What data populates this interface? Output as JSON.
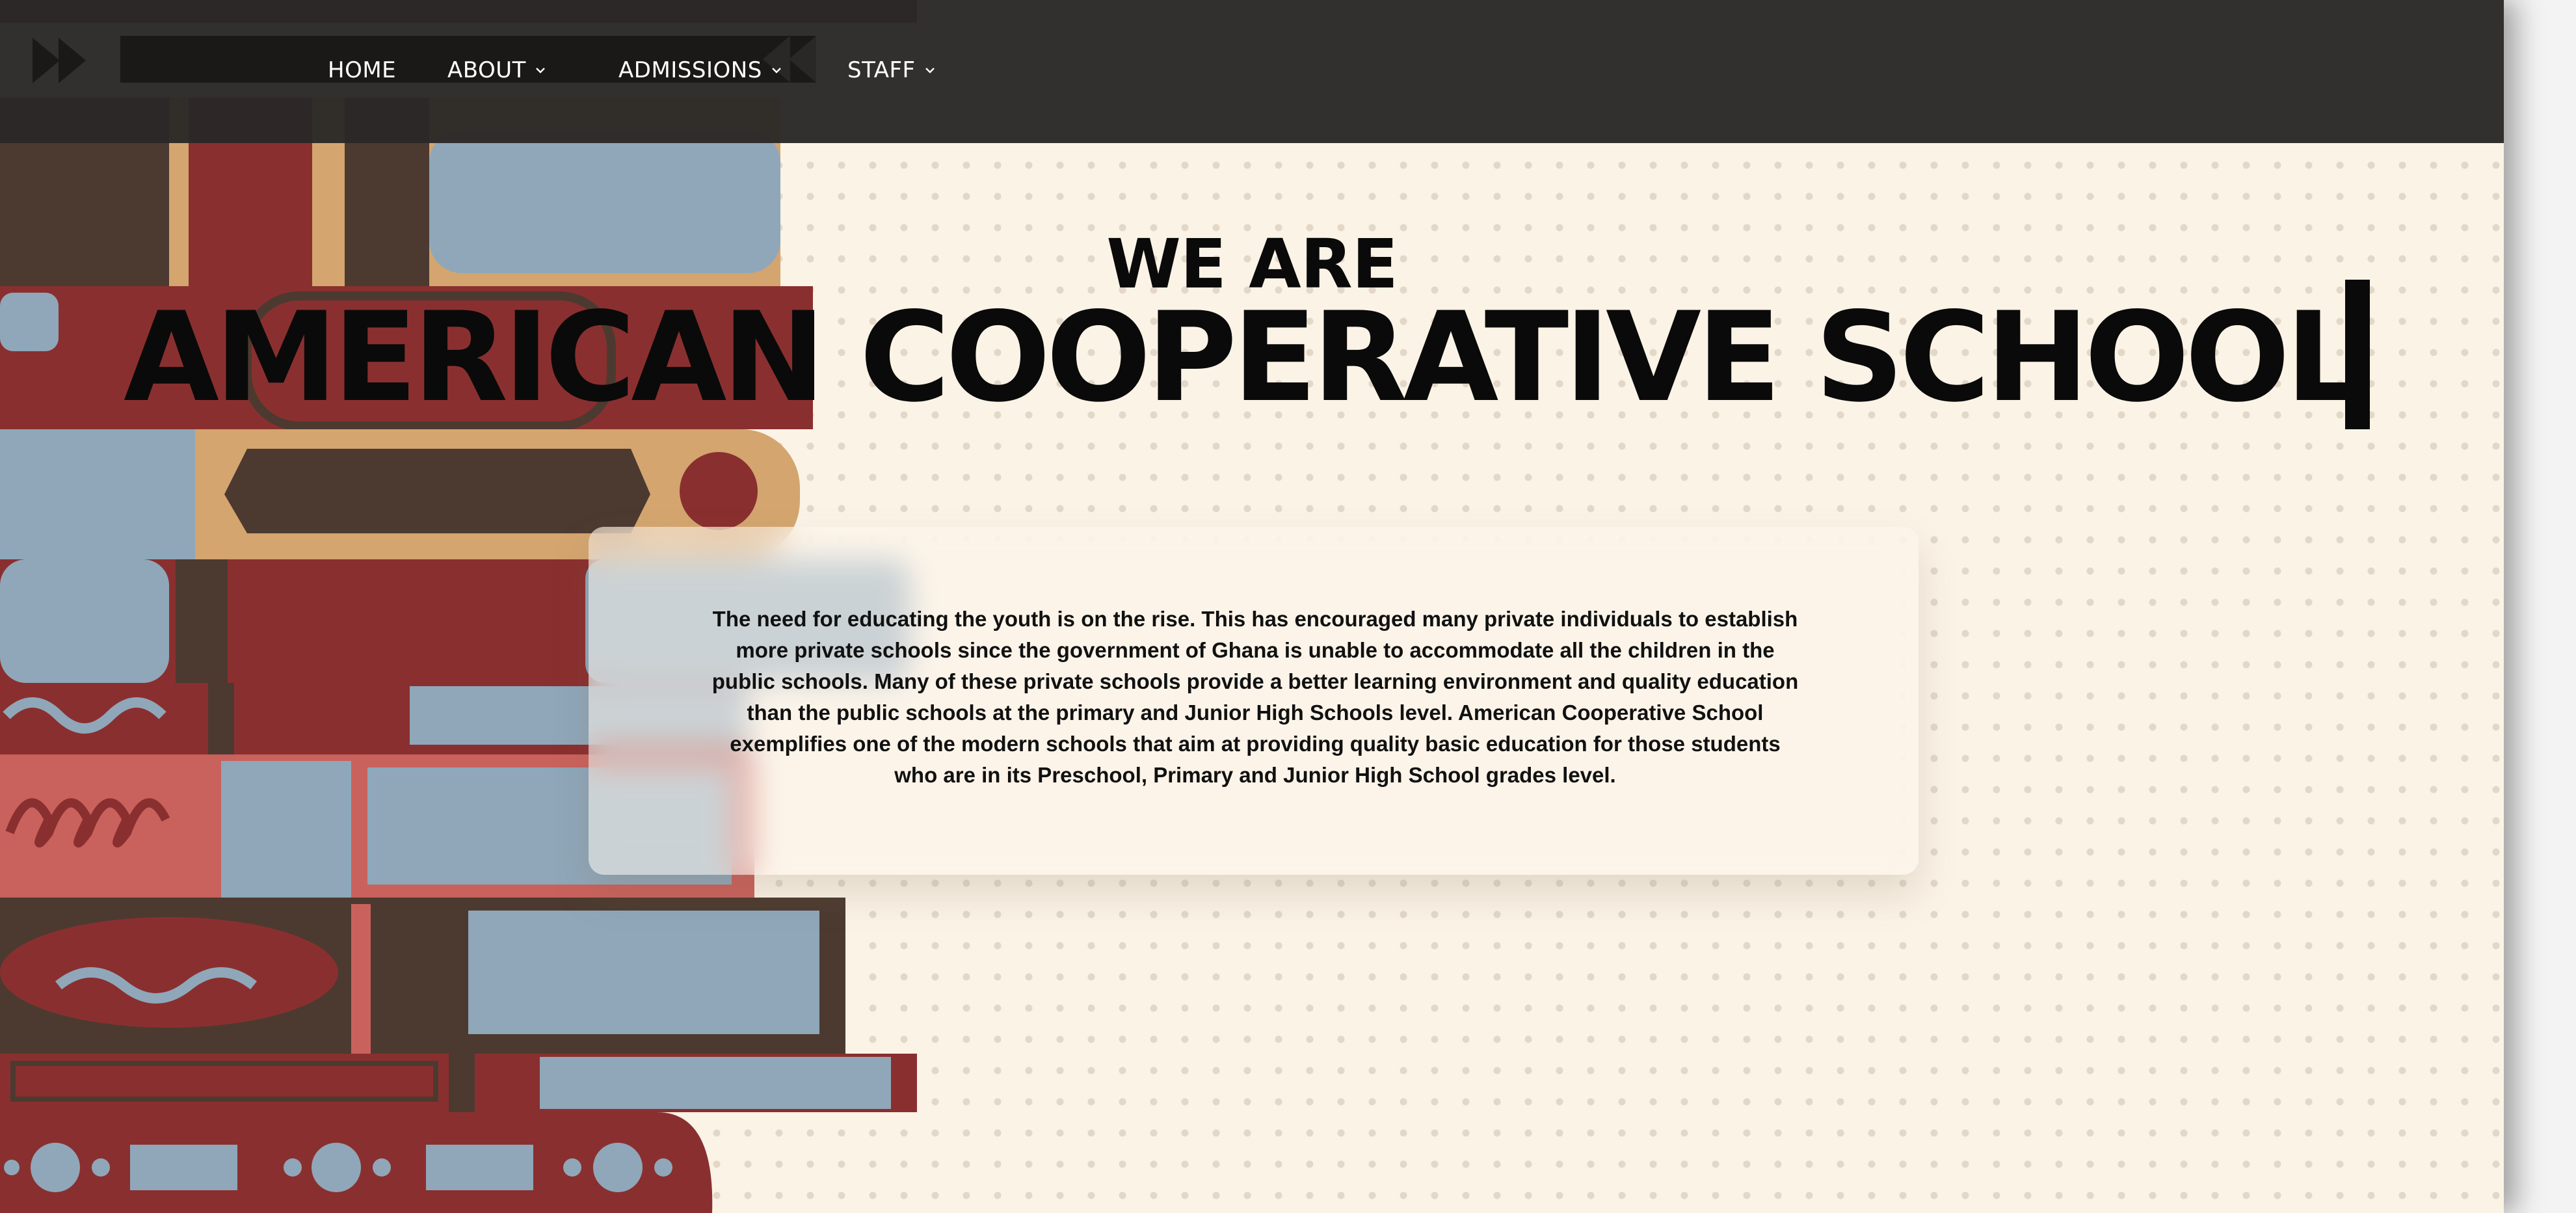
{
  "nav": {
    "items": [
      {
        "label": "HOME",
        "has_dropdown": false
      },
      {
        "label": "ABOUT",
        "has_dropdown": true
      },
      {
        "label": "ADMISSIONS",
        "has_dropdown": true
      },
      {
        "label": "STAFF",
        "has_dropdown": true
      }
    ]
  },
  "hero": {
    "eyebrow": "WE ARE",
    "title": "AMERICAN COOPERATIVE SCHOOL"
  },
  "intro": {
    "text": "The need for educating the youth is on the rise. This has encouraged many private individuals to establish more private schools since the government of Ghana is unable to accommodate all the children in the public schools. Many of these private schools provide a better learning environment and quality education than the public schools at the primary and Junior High Schools level. American Cooperative School exemplifies one of the modern schools that aim at providing quality basic education for those students who are in its Preschool, Primary and Junior High School grades level."
  },
  "icons": [
    "fast-forward-icon",
    "rewind-icon",
    "chevron-down-icon"
  ],
  "colors": {
    "navbar": "#2a2827",
    "page_background": "#fbf3e6",
    "book_red": "#8a2f2f",
    "book_blue": "#8fa7b9",
    "book_tan": "#d4a56f",
    "book_brown": "#4c3a30",
    "text": "#0a0a0a"
  }
}
